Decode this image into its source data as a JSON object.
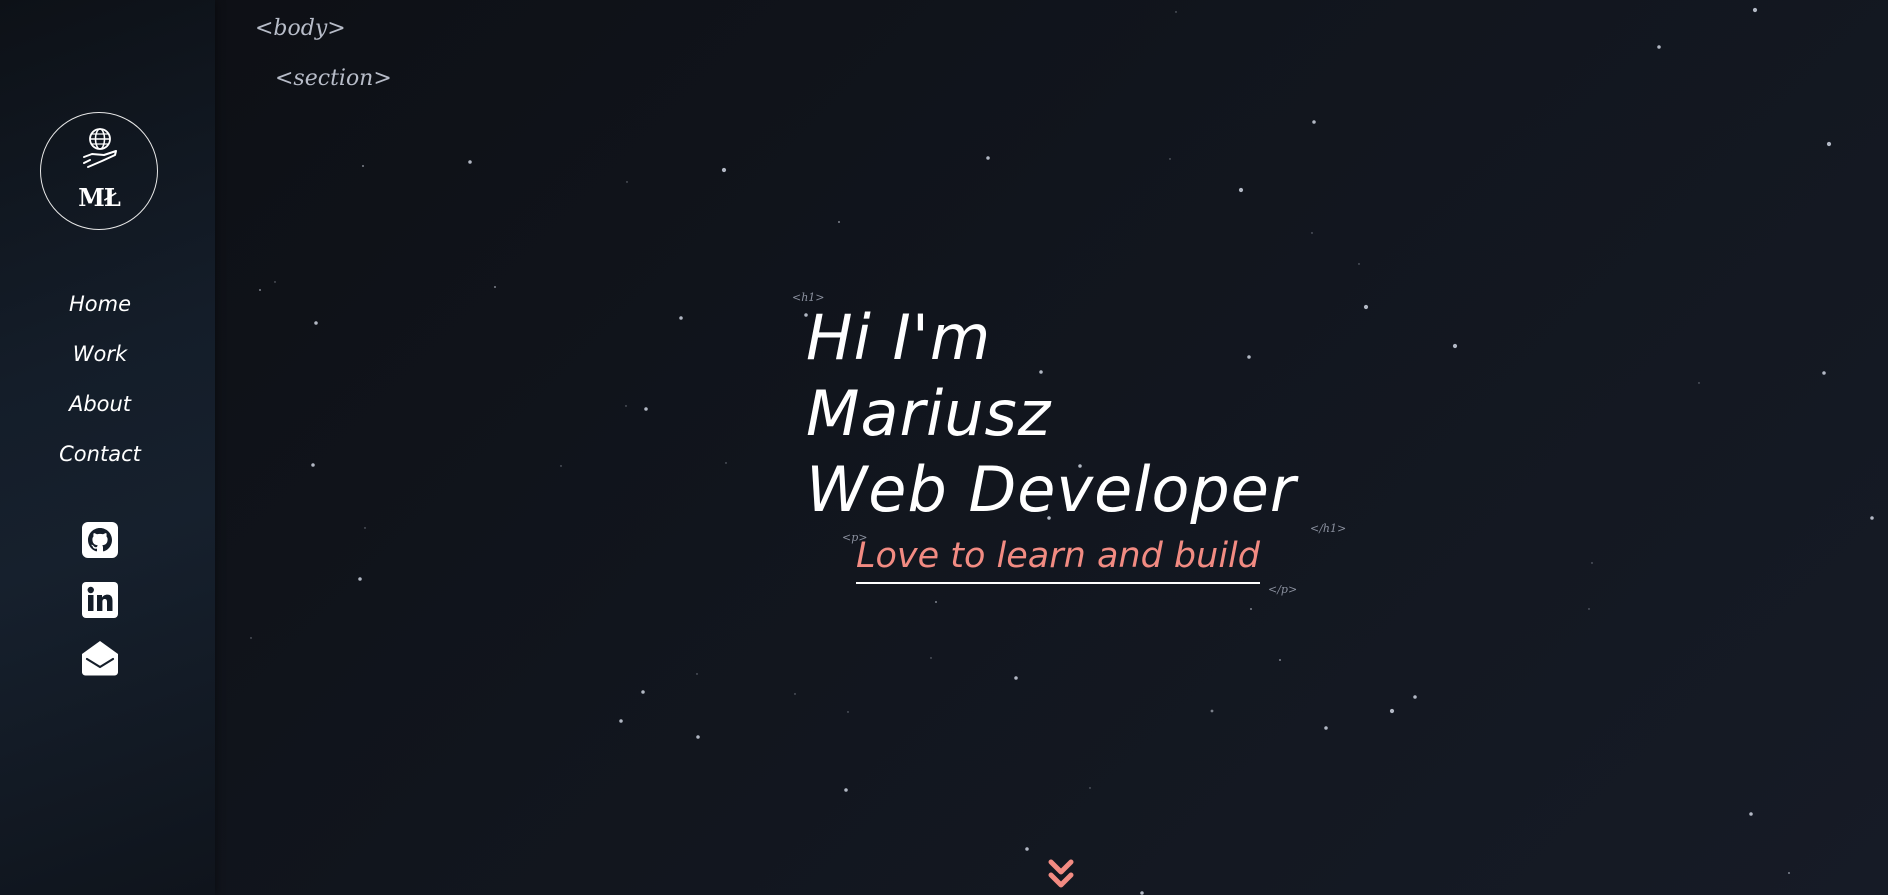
{
  "logo": {
    "icon": "globe-hand-icon",
    "text": "MŁ"
  },
  "nav": {
    "items": [
      {
        "label": "Home"
      },
      {
        "label": "Work"
      },
      {
        "label": "About"
      },
      {
        "label": "Contact"
      }
    ]
  },
  "social": {
    "github": {
      "icon": "github-icon"
    },
    "linkedin": {
      "icon": "linkedin-icon"
    },
    "email": {
      "icon": "email-open-icon"
    }
  },
  "tags": {
    "body_open": "<body>",
    "section_open": "<section>",
    "h1_open": "<h1>",
    "h1_close": "</h1>",
    "p_open": "<p>",
    "p_close": "</p>"
  },
  "hero": {
    "line1": "Hi I'm",
    "line2": "Mariusz",
    "line3": "Web Developer",
    "subtitle": "Love to learn and build"
  },
  "scroll_icon": "chevron-double-down-icon",
  "colors": {
    "background": "#0f131a",
    "sidebar": "#141d29",
    "text": "#ffffff",
    "accent": "#f28b82",
    "tag": "#b7bcc8"
  }
}
